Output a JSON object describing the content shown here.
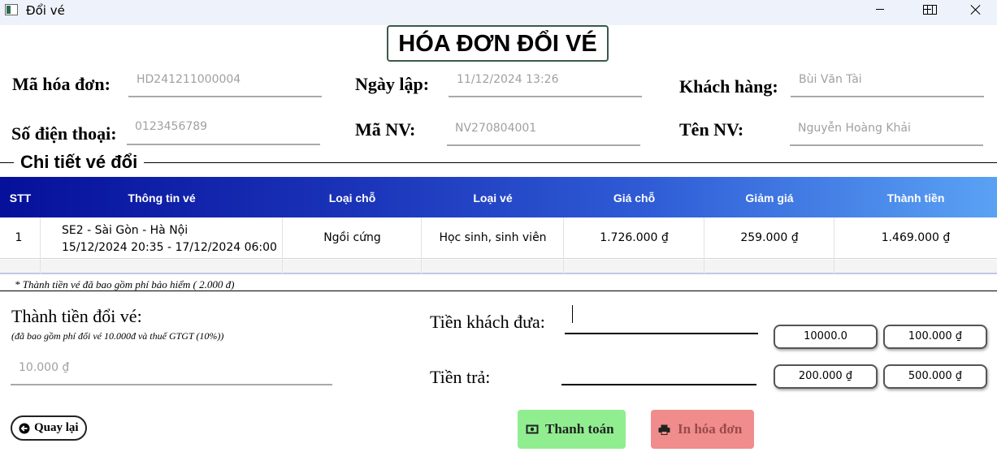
{
  "window": {
    "title": "Đổi vé"
  },
  "form_title": "HÓA ĐƠN ĐỔI VÉ",
  "fields": {
    "ma_hoa_don": {
      "label": "Mã hóa đơn:",
      "value": "HD241211000004"
    },
    "ngay_lap": {
      "label": "Ngày lập:",
      "value": "11/12/2024 13:26"
    },
    "khach_hang": {
      "label": "Khách hàng:",
      "value": "Bùi Văn Tài"
    },
    "so_dien_thoai": {
      "label": "Số điện thoại:",
      "value": "0123456789"
    },
    "ma_nv": {
      "label": "Mã NV:",
      "value": "NV270804001"
    },
    "ten_nv": {
      "label": "Tên NV:",
      "value": "Nguyễn Hoàng Khải"
    }
  },
  "section_title": "Chi tiết vé đổi",
  "table": {
    "columns": [
      "STT",
      "Thông tin vé",
      "Loại chỗ",
      "Loại vé",
      "Giá chỗ",
      "Giảm giá",
      "Thành tiền"
    ],
    "rows": [
      {
        "stt": "1",
        "thong_tin_line1": "SE2 - Sài Gòn - Hà Nội",
        "thong_tin_line2": "15/12/2024 20:35 - 17/12/2024 06:00",
        "loai_cho": "Ngồi cứng",
        "loai_ve": "Học sinh, sinh viên",
        "gia_cho": "1.726.000 ₫",
        "giam_gia": "259.000 ₫",
        "thanh_tien": "1.469.000 ₫"
      }
    ]
  },
  "table_note": "* Thành tiền vé đã bao gồm phí bảo hiểm ( 2.000 đ)",
  "total": {
    "label": "Thành tiền đổi vé:",
    "note": "(đã bao gồm phí đổi vé 10.000đ và thuế GTGT (10%))",
    "value": "10.000 ₫"
  },
  "payment": {
    "cash_label": "Tiền khách đưa:",
    "cash_value": "",
    "change_label": "Tiền trả:",
    "change_value": "",
    "quick_amounts": [
      "10000.0",
      "100.000 ₫",
      "200.000 ₫",
      "500.000 ₫"
    ]
  },
  "buttons": {
    "back": "Quay lại",
    "pay": "Thanh toán",
    "print": "In hóa đơn"
  },
  "colors": {
    "header_gradient_start": "#06109a",
    "header_gradient_end": "#5aa2f4",
    "pay_button": "#90ee90",
    "print_button": "#f08c8c"
  },
  "icons": {
    "back": "arrow-left-icon",
    "pay": "cash-icon",
    "print": "printer-icon"
  }
}
